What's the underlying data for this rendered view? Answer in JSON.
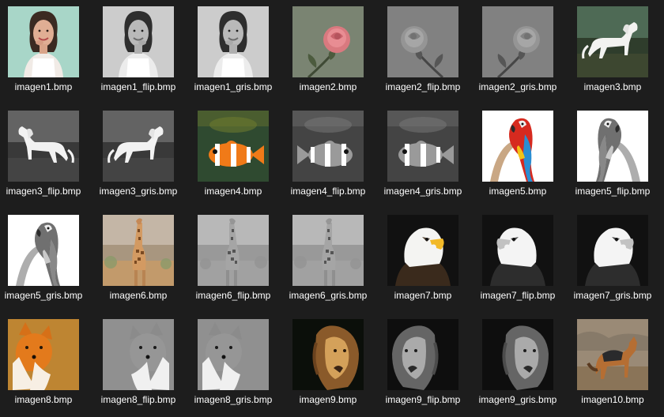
{
  "files": [
    {
      "name": "imagen1.bmp",
      "icon": "woman-portrait-color-thumbnail"
    },
    {
      "name": "imagen1_flip.bmp",
      "icon": "woman-portrait-gray-thumbnail"
    },
    {
      "name": "imagen1_gris.bmp",
      "icon": "woman-portrait-gray-thumbnail"
    },
    {
      "name": "imagen2.bmp",
      "icon": "pink-rose-thumbnail"
    },
    {
      "name": "imagen2_flip.bmp",
      "icon": "rose-gray-thumbnail"
    },
    {
      "name": "imagen2_gris.bmp",
      "icon": "rose-gray-thumbnail"
    },
    {
      "name": "imagen3.bmp",
      "icon": "white-horse-color-thumbnail"
    },
    {
      "name": "imagen3_flip.bmp",
      "icon": "white-horse-gray-thumbnail"
    },
    {
      "name": "imagen3_gris.bmp",
      "icon": "white-horse-gray-thumbnail"
    },
    {
      "name": "imagen4.bmp",
      "icon": "clownfish-color-thumbnail"
    },
    {
      "name": "imagen4_flip.bmp",
      "icon": "clownfish-gray-thumbnail"
    },
    {
      "name": "imagen4_gris.bmp",
      "icon": "clownfish-gray-thumbnail"
    },
    {
      "name": "imagen5.bmp",
      "icon": "macaw-parrot-color-thumbnail"
    },
    {
      "name": "imagen5_flip.bmp",
      "icon": "macaw-parrot-gray-thumbnail"
    },
    {
      "name": "imagen5_gris.bmp",
      "icon": "macaw-parrot-gray-thumbnail"
    },
    {
      "name": "imagen6.bmp",
      "icon": "giraffe-color-thumbnail"
    },
    {
      "name": "imagen6_flip.bmp",
      "icon": "giraffe-gray-thumbnail"
    },
    {
      "name": "imagen6_gris.bmp",
      "icon": "giraffe-gray-thumbnail"
    },
    {
      "name": "imagen7.bmp",
      "icon": "bald-eagle-color-thumbnail"
    },
    {
      "name": "imagen7_flip.bmp",
      "icon": "bald-eagle-gray-thumbnail"
    },
    {
      "name": "imagen7_gris.bmp",
      "icon": "bald-eagle-gray-thumbnail"
    },
    {
      "name": "imagen8.bmp",
      "icon": "fox-color-thumbnail"
    },
    {
      "name": "imagen8_flip.bmp",
      "icon": "fox-gray-thumbnail"
    },
    {
      "name": "imagen8_gris.bmp",
      "icon": "fox-gray-thumbnail"
    },
    {
      "name": "imagen9.bmp",
      "icon": "lion-color-thumbnail"
    },
    {
      "name": "imagen9_flip.bmp",
      "icon": "lion-gray-thumbnail"
    },
    {
      "name": "imagen9_gris.bmp",
      "icon": "lion-gray-thumbnail"
    },
    {
      "name": "imagen10.bmp",
      "icon": "jackal-color-thumbnail"
    }
  ],
  "colors": {
    "background": "#1d1d1d",
    "text": "#ffffff"
  }
}
